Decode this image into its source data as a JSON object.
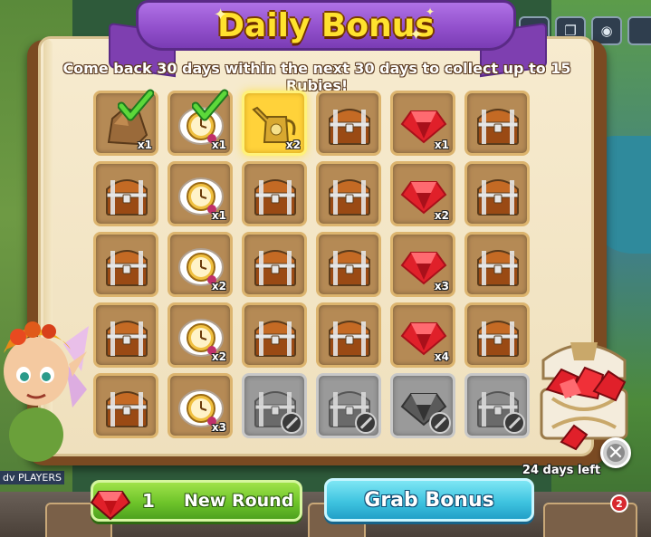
{
  "title": "Daily Bonus",
  "subtitle": "Come back 30 days within the next 30 days to collect up to 15 Rubies!",
  "days_left": "24 days left",
  "buttons": {
    "new_round_count": "1",
    "new_round_label": "New Round",
    "grab_label": "Grab Bonus"
  },
  "side_label": "dv PLAYERS",
  "notification_count": "2",
  "close_icon": "close-icon",
  "colors": {
    "ribbon": "#9250cc",
    "title_text": "#ffe22e",
    "ruby": "#e0202a",
    "new_round_button": "#6ec42a",
    "grab_button": "#3fc4e0",
    "today_highlight": "#ffd23a"
  },
  "grid": [
    [
      {
        "item": "rock",
        "qty": "x1",
        "state": "collected"
      },
      {
        "item": "clock",
        "qty": "x1",
        "state": "collected"
      },
      {
        "item": "watering-can",
        "qty": "x2",
        "state": "today"
      },
      {
        "item": "chest",
        "qty": "",
        "state": "hidden"
      },
      {
        "item": "ruby",
        "qty": "x1",
        "state": "available"
      },
      {
        "item": "chest",
        "qty": "",
        "state": "hidden"
      }
    ],
    [
      {
        "item": "chest",
        "qty": "",
        "state": "hidden"
      },
      {
        "item": "clock",
        "qty": "x1",
        "state": "available"
      },
      {
        "item": "chest",
        "qty": "",
        "state": "hidden"
      },
      {
        "item": "chest",
        "qty": "",
        "state": "hidden"
      },
      {
        "item": "ruby",
        "qty": "x2",
        "state": "available"
      },
      {
        "item": "chest",
        "qty": "",
        "state": "hidden"
      }
    ],
    [
      {
        "item": "chest",
        "qty": "",
        "state": "hidden"
      },
      {
        "item": "clock",
        "qty": "x2",
        "state": "available"
      },
      {
        "item": "chest",
        "qty": "",
        "state": "hidden"
      },
      {
        "item": "chest",
        "qty": "",
        "state": "hidden"
      },
      {
        "item": "ruby",
        "qty": "x3",
        "state": "available"
      },
      {
        "item": "chest",
        "qty": "",
        "state": "hidden"
      }
    ],
    [
      {
        "item": "chest",
        "qty": "",
        "state": "hidden"
      },
      {
        "item": "clock",
        "qty": "x2",
        "state": "available"
      },
      {
        "item": "chest",
        "qty": "",
        "state": "hidden"
      },
      {
        "item": "chest",
        "qty": "",
        "state": "hidden"
      },
      {
        "item": "ruby",
        "qty": "x4",
        "state": "available"
      },
      {
        "item": "chest",
        "qty": "",
        "state": "hidden"
      }
    ],
    [
      {
        "item": "chest",
        "qty": "",
        "state": "hidden"
      },
      {
        "item": "clock",
        "qty": "x3",
        "state": "available"
      },
      {
        "item": "chest",
        "qty": "",
        "state": "locked"
      },
      {
        "item": "chest",
        "qty": "",
        "state": "locked"
      },
      {
        "item": "ruby",
        "qty": "",
        "state": "locked"
      },
      {
        "item": "chest",
        "qty": "",
        "state": "locked"
      }
    ]
  ]
}
